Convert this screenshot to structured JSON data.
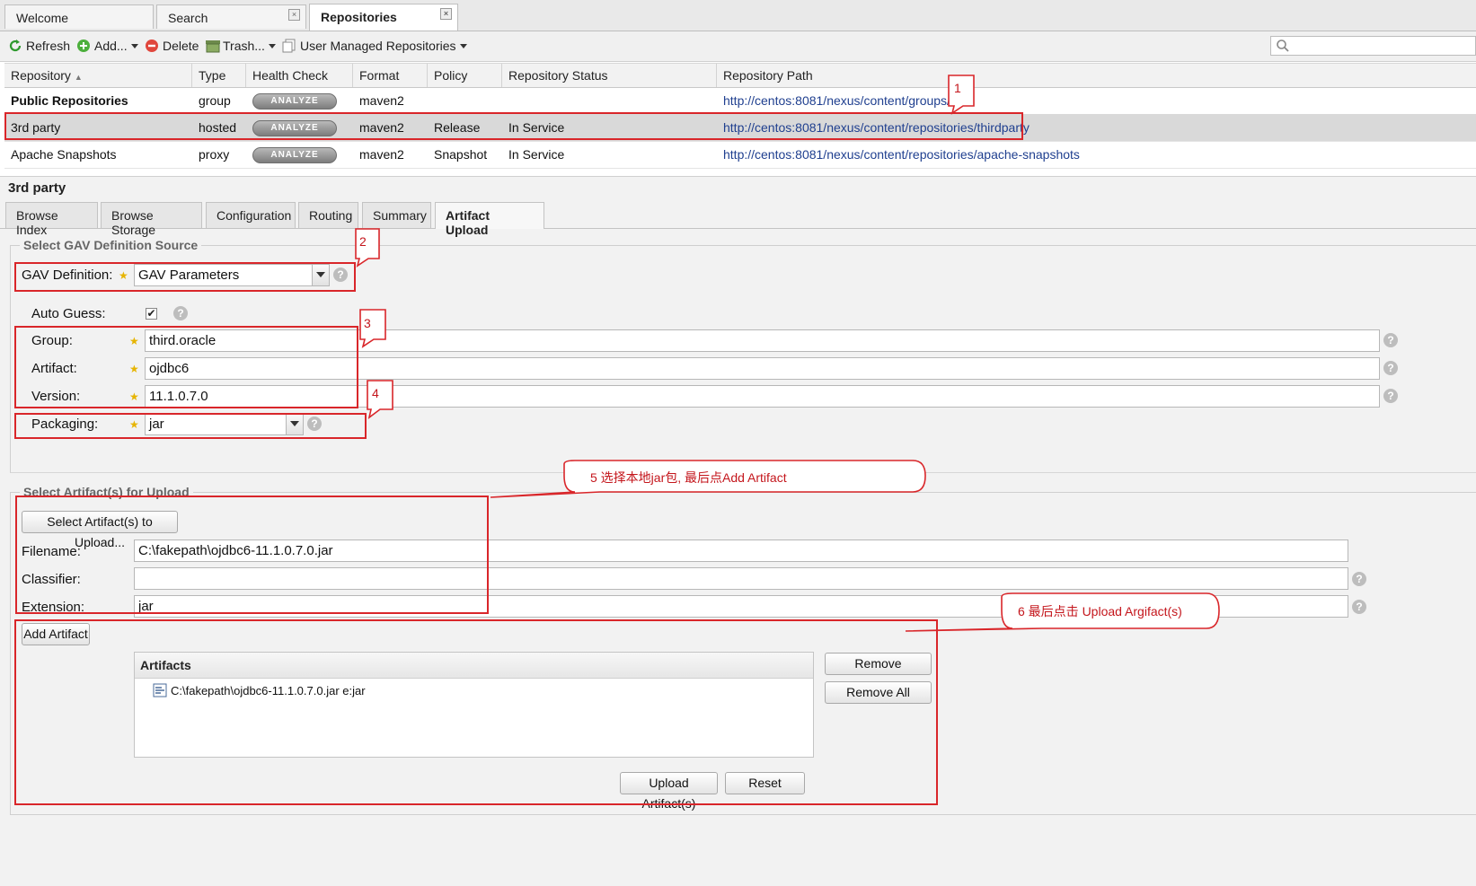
{
  "top_tabs": [
    {
      "label": "Welcome",
      "closable": false
    },
    {
      "label": "Search",
      "closable": true
    },
    {
      "label": "Repositories",
      "closable": true,
      "active": true
    }
  ],
  "toolbar": {
    "refresh": "Refresh",
    "add": "Add...",
    "delete": "Delete",
    "trash": "Trash...",
    "user_managed": "User Managed Repositories"
  },
  "grid": {
    "columns": [
      "Repository",
      "Type",
      "Health Check",
      "Format",
      "Policy",
      "Repository Status",
      "Repository Path"
    ],
    "analyze_label": "ANALYZE",
    "rows": [
      {
        "name": "Public Repositories",
        "type": "group",
        "format": "maven2",
        "policy": "",
        "status": "",
        "path": "http://centos:8081/nexus/content/groups/pu"
      },
      {
        "name": "3rd party",
        "type": "hosted",
        "format": "maven2",
        "policy": "Release",
        "status": "In Service",
        "path": "http://centos:8081/nexus/content/repositories/thirdparty"
      },
      {
        "name": "Apache Snapshots",
        "type": "proxy",
        "format": "maven2",
        "policy": "Snapshot",
        "status": "In Service",
        "path": "http://centos:8081/nexus/content/repositories/apache-snapshots"
      }
    ]
  },
  "detail": {
    "title": "3rd party",
    "tabs": [
      "Browse Index",
      "Browse Storage",
      "Configuration",
      "Routing",
      "Summary",
      "Artifact Upload"
    ],
    "gav_section": {
      "legend": "Select GAV Definition Source",
      "gav_label": "GAV Definition:",
      "gav_value": "GAV Parameters",
      "auto_guess_label": "Auto Guess:",
      "group_label": "Group:",
      "group_value": "third.oracle",
      "artifact_label": "Artifact:",
      "artifact_value": "ojdbc6",
      "version_label": "Version:",
      "version_value": "11.1.0.7.0",
      "packaging_label": "Packaging:",
      "packaging_value": "jar"
    },
    "upload_section": {
      "legend": "Select Artifact(s) for Upload",
      "select_button": "Select Artifact(s) to Upload...",
      "filename_label": "Filename:",
      "filename_value": "C:\\fakepath\\ojdbc6-11.1.0.7.0.jar",
      "classifier_label": "Classifier:",
      "classifier_value": "",
      "extension_label": "Extension:",
      "extension_value": "jar",
      "add_artifact": "Add Artifact",
      "artifacts_header": "Artifacts",
      "artifact_item": "C:\\fakepath\\ojdbc6-11.1.0.7.0.jar e:jar",
      "remove": "Remove",
      "remove_all": "Remove All",
      "upload": "Upload Artifact(s)",
      "reset": "Reset"
    }
  },
  "annotations": {
    "n1": "1",
    "n2": "2",
    "n3": "3",
    "n4": "4",
    "n5": "5 选择本地jar包, 最后点Add Artifact",
    "n6": "6 最后点击 Upload Argifact(s)"
  },
  "help_glyph": "?",
  "colors": {
    "annotation_red": "#d9262a",
    "link": "#1f3f8f",
    "selected_row": "#d9d9d9"
  }
}
